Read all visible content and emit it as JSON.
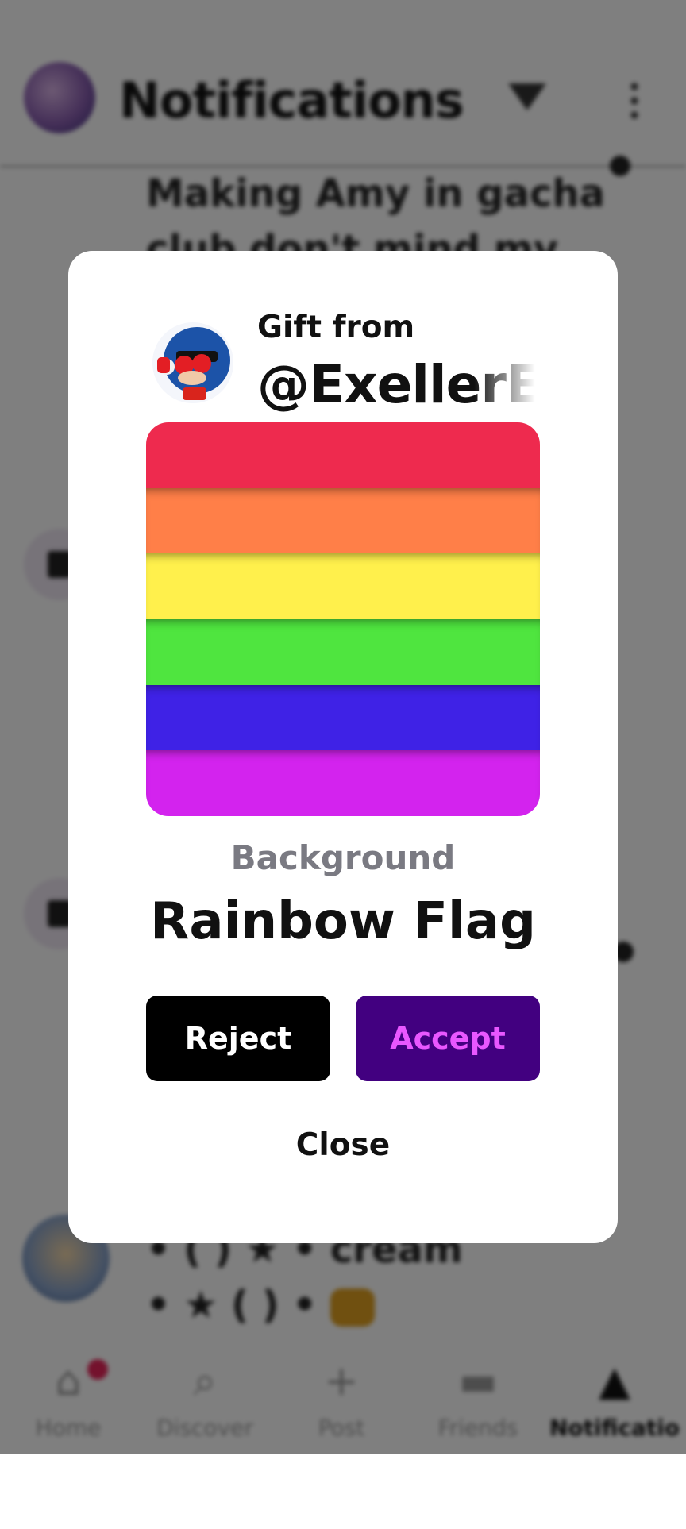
{
  "header": {
    "title": "Notifications",
    "filter_icon": "filter-icon",
    "more_icon": "more-vertical-icon"
  },
  "background_list": {
    "line1": "Making Amy in gacha",
    "line2": "club don't mind my",
    "line3": "• ( ) ★ • cream",
    "line4": "• ★ ( ) •"
  },
  "bottom_nav": {
    "items": [
      {
        "label": "Home",
        "icon": "home-icon",
        "badge": true
      },
      {
        "label": "Discover",
        "icon": "search-icon"
      },
      {
        "label": "Post",
        "icon": "plus-icon"
      },
      {
        "label": "Friends",
        "icon": "chat-bubbles-icon"
      },
      {
        "label": "Notificatio",
        "icon": "bell-icon",
        "active": true
      }
    ]
  },
  "gift_modal": {
    "from_label": "Gift from",
    "username": "@ExellerEx",
    "item_kind": "Background",
    "item_name": "Rainbow Flag",
    "stripes": [
      "#ee2a4e",
      "#ff7f48",
      "#fff04c",
      "#4fe53f",
      "#3f22e6",
      "#d323ee"
    ],
    "reject_label": "Reject",
    "accept_label": "Accept",
    "close_label": "Close"
  },
  "colors": {
    "accept_bg": "#420080",
    "accept_text": "#e957ff",
    "reject_bg": "#000000",
    "badge": "#e8245a"
  }
}
